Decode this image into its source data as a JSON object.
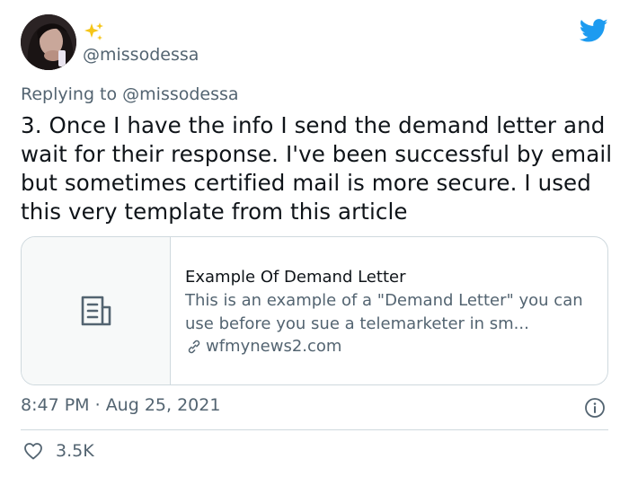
{
  "author": {
    "handle": "@missodessa",
    "name_emoji": "sparkles-icon"
  },
  "reply": {
    "prefix": "Replying to ",
    "mention": "@missodessa"
  },
  "tweet": {
    "text": "3. Once I have the info I send the demand letter and wait for their response. I've been successful by email but sometimes certified mail is more secure. I used this very template from this article"
  },
  "card": {
    "title": "Example Of Demand Letter",
    "description": "This is an example of a \"Demand Letter\" you can use before you sue a telemarketer in sm...",
    "domain": "wfmynews2.com"
  },
  "meta": {
    "time": "8:47 PM",
    "separator": " · ",
    "date": "Aug 25, 2021"
  },
  "engagement": {
    "likes": "3.5K"
  },
  "colors": {
    "twitter_blue": "#1d9bf0",
    "secondary_text": "#536471",
    "primary_text": "#0f1419",
    "border": "#cfd9de",
    "sparkle": "#f5c518"
  }
}
